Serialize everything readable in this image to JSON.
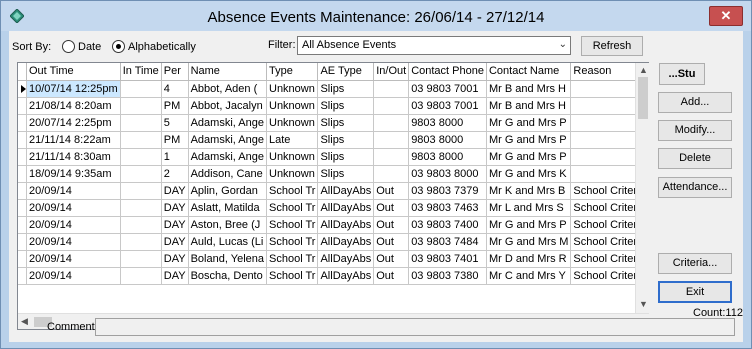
{
  "window": {
    "title": "Absence Events Maintenance: 26/06/14 - 27/12/14",
    "close_label": "✕"
  },
  "sort": {
    "label": "Sort By:",
    "options": [
      "Date",
      "Alphabetically"
    ],
    "selected": "Alphabetically"
  },
  "filter": {
    "label": "Filter:",
    "value": "All Absence Events",
    "refresh_label": "Refresh"
  },
  "table": {
    "columns": [
      "Out Time",
      "In Time",
      "Per",
      "Name",
      "Type",
      "AE Type",
      "In/Out",
      "Contact Phone",
      "Contact Name",
      "Reason"
    ],
    "rows": [
      [
        "10/07/14 12:25pm",
        "",
        "4",
        "Abbot, Aden (",
        "Unknown",
        "Slips",
        "",
        "03 9803 7001",
        "Mr B and Mrs H",
        ""
      ],
      [
        "21/08/14 8:20am",
        "",
        "PM",
        "Abbot, Jacalyn",
        "Unknown",
        "Slips",
        "",
        "03 9803 7001",
        "Mr B and Mrs H",
        ""
      ],
      [
        "20/07/14 2:25pm",
        "",
        "5",
        "Adamski, Ange",
        "Unknown",
        "Slips",
        "",
        "9803 8000",
        "Mr G and Mrs P",
        ""
      ],
      [
        "21/11/14 8:22am",
        "",
        "PM",
        "Adamski, Ange",
        "Late",
        "Slips",
        "",
        "9803 8000",
        "Mr G and Mrs P",
        ""
      ],
      [
        "21/11/14 8:30am",
        "",
        "1",
        "Adamski, Ange",
        "Unknown",
        "Slips",
        "",
        "9803 8000",
        "Mr G and Mrs P",
        ""
      ],
      [
        "18/09/14 9:35am",
        "",
        "2",
        "Addison, Cane",
        "Unknown",
        "Slips",
        "",
        "03 9803 8000",
        "Mr G and Mrs K",
        ""
      ],
      [
        "20/09/14",
        "",
        "DAY",
        "Aplin, Gordan",
        "School Tr",
        "AllDayAbs",
        "Out",
        "03 9803 7379",
        "Mr K and Mrs B",
        "School Criteria"
      ],
      [
        "20/09/14",
        "",
        "DAY",
        "Aslatt, Matilda",
        "School Tr",
        "AllDayAbs",
        "Out",
        "03 9803 7463",
        "Mr L and Mrs S",
        "School Criteria"
      ],
      [
        "20/09/14",
        "",
        "DAY",
        "Aston, Bree (J",
        "School Tr",
        "AllDayAbs",
        "Out",
        "03 9803 7400",
        "Mr G and Mrs P",
        "School Criteria"
      ],
      [
        "20/09/14",
        "",
        "DAY",
        "Auld, Lucas (Li",
        "School Tr",
        "AllDayAbs",
        "Out",
        "03 9803 7484",
        "Mr G and Mrs M",
        "School Criteria"
      ],
      [
        "20/09/14",
        "",
        "DAY",
        "Boland, Yelena",
        "School Tr",
        "AllDayAbs",
        "Out",
        "03 9803 7401",
        "Mr D and Mrs R",
        "School Criteria"
      ],
      [
        "20/09/14",
        "",
        "DAY",
        "Boscha, Dento",
        "School Tr",
        "AllDayAbs",
        "Out",
        "03 9803 7380",
        "Mr C and Mrs Y",
        "School Criteria"
      ]
    ],
    "selected_row": 0
  },
  "buttons": {
    "stu": "...Stu",
    "add": "Add...",
    "modify": "Modify...",
    "delete": "Delete",
    "attendance": "Attendance...",
    "criteria": "Criteria...",
    "exit": "Exit"
  },
  "count": "Count:112",
  "comment": {
    "label": "Comment:",
    "value": ""
  },
  "colors": {
    "title_bar": "#c4d8ee",
    "close_button": "#c75050",
    "selected_cell": "#cce8ff",
    "default_button_border": "#2f6dcc"
  }
}
